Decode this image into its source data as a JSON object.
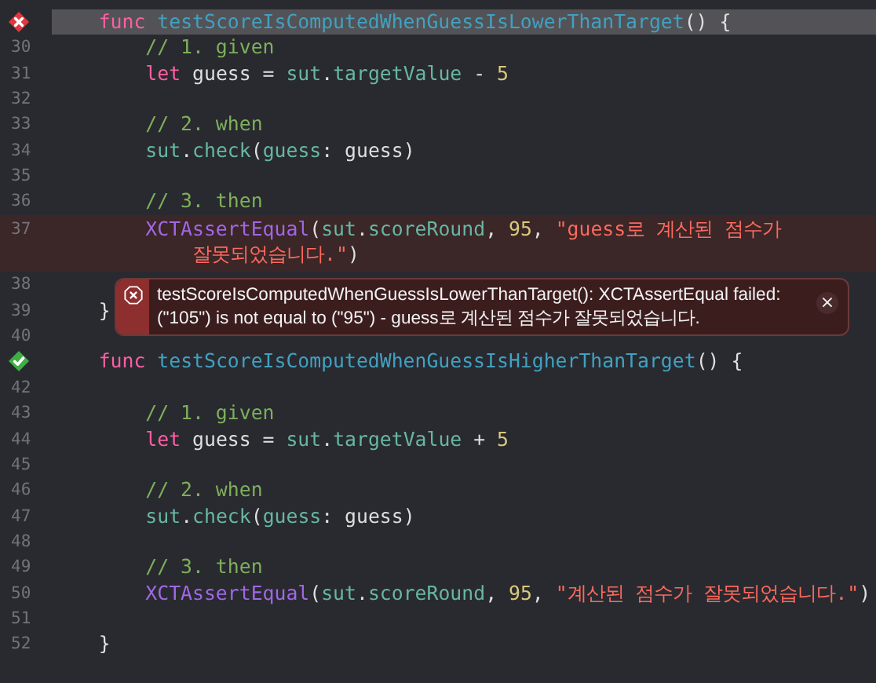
{
  "editor": {
    "lines": [
      {
        "test_passed": false,
        "current": true,
        "error": false,
        "tokens": [
          {
            "kind": "kw",
            "text": "    func"
          },
          {
            "kind": "decl",
            "text": " testScoreIsComputedWhenGuessIsLowerThanTarget"
          },
          {
            "kind": "plain",
            "text": "() {"
          }
        ]
      },
      {
        "number": "30",
        "current": false,
        "error": false,
        "tokens": [
          {
            "kind": "comment",
            "text": "        // 1. given"
          }
        ]
      },
      {
        "number": "31",
        "current": false,
        "error": false,
        "tokens": [
          {
            "kind": "kw",
            "text": "        let"
          },
          {
            "kind": "plain",
            "text": " guess = "
          },
          {
            "kind": "member",
            "text": "sut"
          },
          {
            "kind": "plain",
            "text": "."
          },
          {
            "kind": "member",
            "text": "targetValue"
          },
          {
            "kind": "plain",
            "text": " - "
          },
          {
            "kind": "num",
            "text": "5"
          }
        ]
      },
      {
        "number": "32",
        "current": false,
        "error": false
      },
      {
        "number": "33",
        "current": false,
        "error": false,
        "tokens": [
          {
            "kind": "comment",
            "text": "        // 2. when"
          }
        ]
      },
      {
        "number": "34",
        "current": false,
        "error": false,
        "tokens": [
          {
            "kind": "member",
            "text": "        sut"
          },
          {
            "kind": "plain",
            "text": "."
          },
          {
            "kind": "member",
            "text": "check"
          },
          {
            "kind": "plain",
            "text": "("
          },
          {
            "kind": "member",
            "text": "guess"
          },
          {
            "kind": "plain",
            "text": ": guess)"
          }
        ]
      },
      {
        "number": "35",
        "current": false,
        "error": false
      },
      {
        "number": "36",
        "current": false,
        "error": false,
        "tokens": [
          {
            "kind": "comment",
            "text": "        // 3. then"
          }
        ]
      },
      {
        "number": "37",
        "current": false,
        "error": true,
        "tokens": [
          {
            "kind": "type",
            "text": "        XCTAssertEqual"
          },
          {
            "kind": "plain",
            "text": "("
          },
          {
            "kind": "member",
            "text": "sut"
          },
          {
            "kind": "plain",
            "text": "."
          },
          {
            "kind": "member",
            "text": "scoreRound"
          },
          {
            "kind": "plain",
            "text": ", "
          },
          {
            "kind": "num",
            "text": "95"
          },
          {
            "kind": "plain",
            "text": ", "
          },
          {
            "kind": "str",
            "text": "\"guess로 계산된 점수가"
          }
        ],
        "continuation": [
          {
            "kind": "str",
            "text": "            잘못되었습니다.\""
          },
          {
            "kind": "plain",
            "text": ")"
          }
        ]
      },
      {
        "number": "38",
        "current": false,
        "error": false
      },
      {
        "number": "39",
        "current": false,
        "error": false,
        "tokens": [
          {
            "kind": "plain",
            "text": "    }"
          }
        ]
      },
      {
        "number": "40",
        "current": false,
        "error": false
      },
      {
        "test_passed": true,
        "current": false,
        "error": false,
        "tokens": [
          {
            "kind": "kw",
            "text": "    func"
          },
          {
            "kind": "decl",
            "text": " testScoreIsComputedWhenGuessIsHigherThanTarget"
          },
          {
            "kind": "plain",
            "text": "() {"
          }
        ]
      },
      {
        "number": "42",
        "current": false,
        "error": false
      },
      {
        "number": "43",
        "current": false,
        "error": false,
        "tokens": [
          {
            "kind": "comment",
            "text": "        // 1. given"
          }
        ]
      },
      {
        "number": "44",
        "current": false,
        "error": false,
        "tokens": [
          {
            "kind": "kw",
            "text": "        let"
          },
          {
            "kind": "plain",
            "text": " guess = "
          },
          {
            "kind": "member",
            "text": "sut"
          },
          {
            "kind": "plain",
            "text": "."
          },
          {
            "kind": "member",
            "text": "targetValue"
          },
          {
            "kind": "plain",
            "text": " + "
          },
          {
            "kind": "num",
            "text": "5"
          }
        ]
      },
      {
        "number": "45",
        "current": false,
        "error": false
      },
      {
        "number": "46",
        "current": false,
        "error": false,
        "tokens": [
          {
            "kind": "comment",
            "text": "        // 2. when"
          }
        ]
      },
      {
        "number": "47",
        "current": false,
        "error": false,
        "tokens": [
          {
            "kind": "member",
            "text": "        sut"
          },
          {
            "kind": "plain",
            "text": "."
          },
          {
            "kind": "member",
            "text": "check"
          },
          {
            "kind": "plain",
            "text": "("
          },
          {
            "kind": "member",
            "text": "guess"
          },
          {
            "kind": "plain",
            "text": ": guess)"
          }
        ]
      },
      {
        "number": "48",
        "current": false,
        "error": false
      },
      {
        "number": "49",
        "current": false,
        "error": false,
        "tokens": [
          {
            "kind": "comment",
            "text": "        // 3. then"
          }
        ]
      },
      {
        "number": "50",
        "current": false,
        "error": false,
        "tokens": [
          {
            "kind": "type",
            "text": "        XCTAssertEqual"
          },
          {
            "kind": "plain",
            "text": "("
          },
          {
            "kind": "member",
            "text": "sut"
          },
          {
            "kind": "plain",
            "text": "."
          },
          {
            "kind": "member",
            "text": "scoreRound"
          },
          {
            "kind": "plain",
            "text": ", "
          },
          {
            "kind": "num",
            "text": "95"
          },
          {
            "kind": "plain",
            "text": ", "
          },
          {
            "kind": "str",
            "text": "\"계산된 점수가 잘못되었습니다.\""
          },
          {
            "kind": "plain",
            "text": ")"
          }
        ]
      },
      {
        "number": "51",
        "current": false,
        "error": false
      },
      {
        "number": "52",
        "current": false,
        "error": false,
        "tokens": [
          {
            "kind": "plain",
            "text": "    }"
          }
        ]
      }
    ],
    "issue": {
      "message": "testScoreIsComputedWhenGuessIsLowerThanTarget(): XCTAssertEqual failed: (\"105\") is not equal to (\"95\") - guess로 계산된 점수가 잘못되었습니다.",
      "close": "×"
    }
  }
}
